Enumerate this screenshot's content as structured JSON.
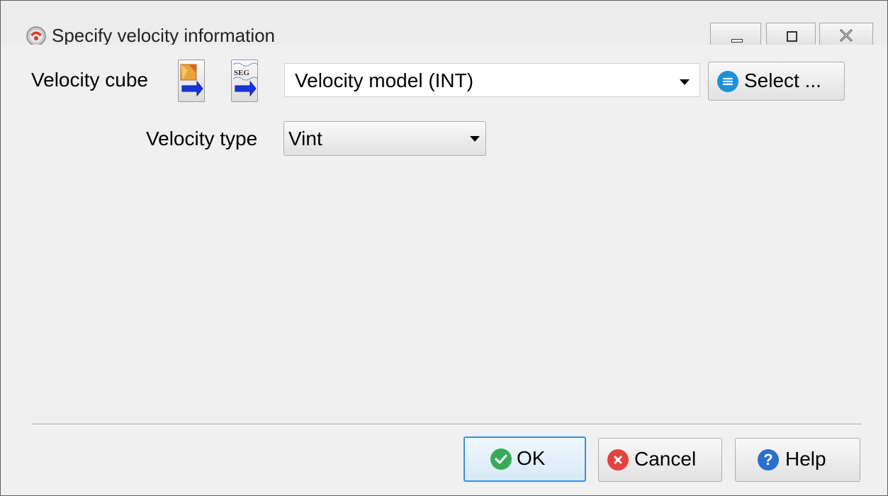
{
  "window": {
    "title": "Specify velocity information"
  },
  "velocity_cube": {
    "label": "Velocity cube",
    "icon_import_1": "import-volume-icon",
    "icon_import_2": "import-segy-icon",
    "segy_icon_text": "SEG",
    "selected_value": "Velocity model (INT)",
    "select_button_label": "Select ..."
  },
  "velocity_type": {
    "label": "Velocity type",
    "selected_value": "Vint"
  },
  "footer": {
    "ok_label": "OK",
    "cancel_label": "Cancel",
    "help_label": "Help"
  },
  "colors": {
    "ok_focus_border": "#3c8fd8",
    "ok_icon": "#3aaa5a",
    "cancel_icon": "#e2433f",
    "help_icon": "#2a6fc9",
    "select_icon": "#1e90d8",
    "arrow_blue": "#1a34e6"
  }
}
